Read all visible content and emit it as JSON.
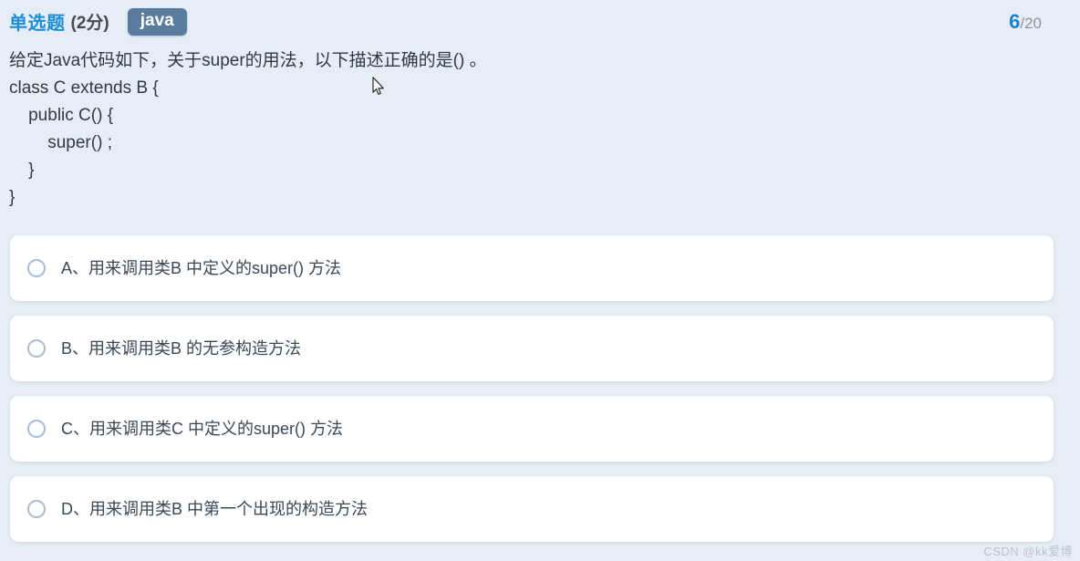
{
  "header": {
    "question_type": "单选题",
    "score": "(2分)",
    "tag": "java",
    "current_index": "6",
    "total": "/20"
  },
  "question": {
    "stem": "给定Java代码如下，关于super的用法，以下描述正确的是() 。",
    "code_lines": [
      "class C extends B {",
      "    public C() {",
      "        super() ;",
      "    }",
      "}"
    ]
  },
  "options": [
    {
      "id": "A",
      "text": "A、用来调用类B 中定义的super() 方法",
      "selected": false
    },
    {
      "id": "B",
      "text": "B、用来调用类B 的无参构造方法",
      "selected": false
    },
    {
      "id": "C",
      "text": "C、用来调用类C 中定义的super() 方法",
      "selected": false
    },
    {
      "id": "D",
      "text": "D、用来调用类B 中第一个出现的构造方法",
      "selected": false
    }
  ],
  "watermark": "CSDN @kk爱博",
  "colors": {
    "page_background": "#e7edf5",
    "accent_blue": "#1a8ed6",
    "counter_blue": "#1681d0",
    "tag_background": "#587b9e",
    "card_background": "#ffffff",
    "radio_border": "#a9bdd2",
    "text_primary": "#2f3a45"
  }
}
